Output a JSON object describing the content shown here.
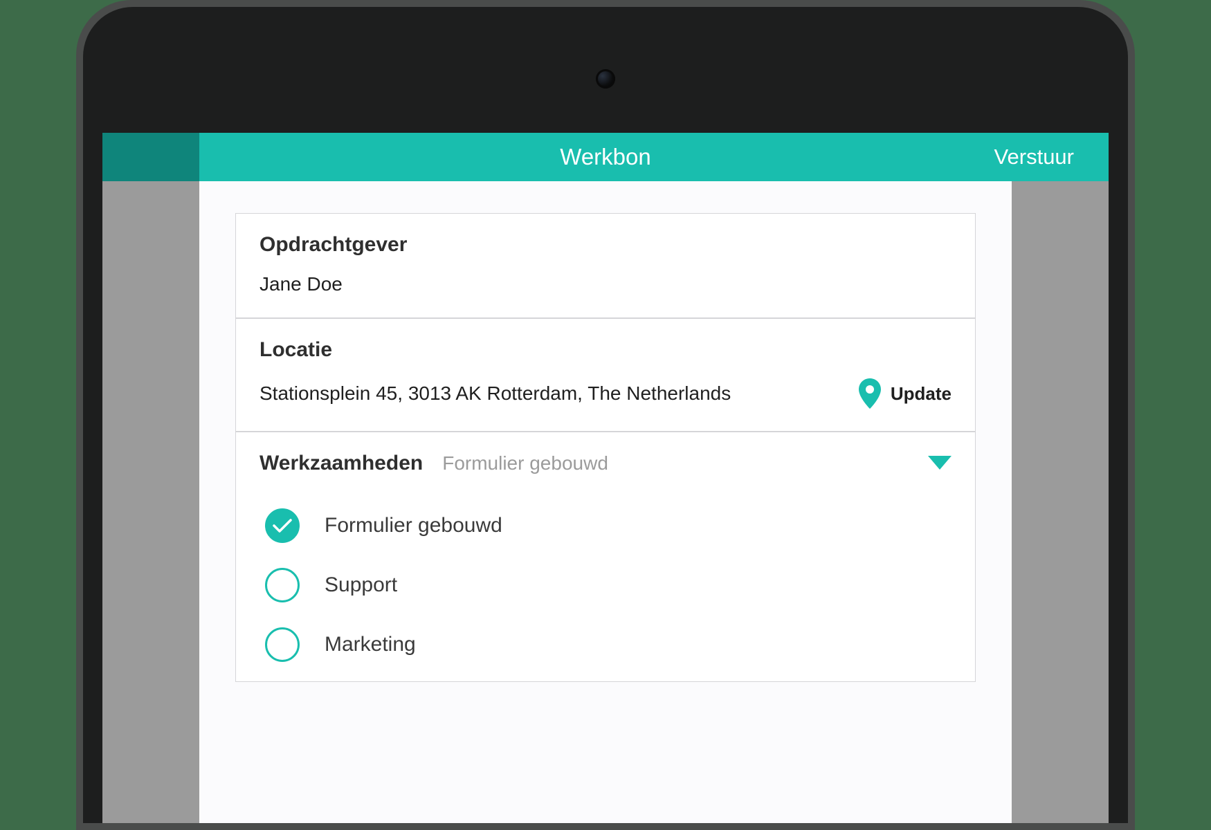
{
  "colors": {
    "accent": "#19beae",
    "accentDark": "#0f857b",
    "backdrop": "#9b9b9b",
    "page": "#3d6b49"
  },
  "header": {
    "title": "Werkbon",
    "send_label": "Verstuur"
  },
  "client": {
    "label": "Opdrachtgever",
    "value": "Jane Doe"
  },
  "location": {
    "label": "Locatie",
    "value": "Stationsplein 45, 3013 AK Rotterdam, The Netherlands",
    "update_label": "Update",
    "pin_icon": "map-pin-icon"
  },
  "activities": {
    "label": "Werkzaamheden",
    "selected": "Formulier gebouwd",
    "caret_icon": "caret-down-icon",
    "options": [
      {
        "label": "Formulier gebouwd",
        "checked": true
      },
      {
        "label": "Support",
        "checked": false
      },
      {
        "label": "Marketing",
        "checked": false
      }
    ]
  }
}
